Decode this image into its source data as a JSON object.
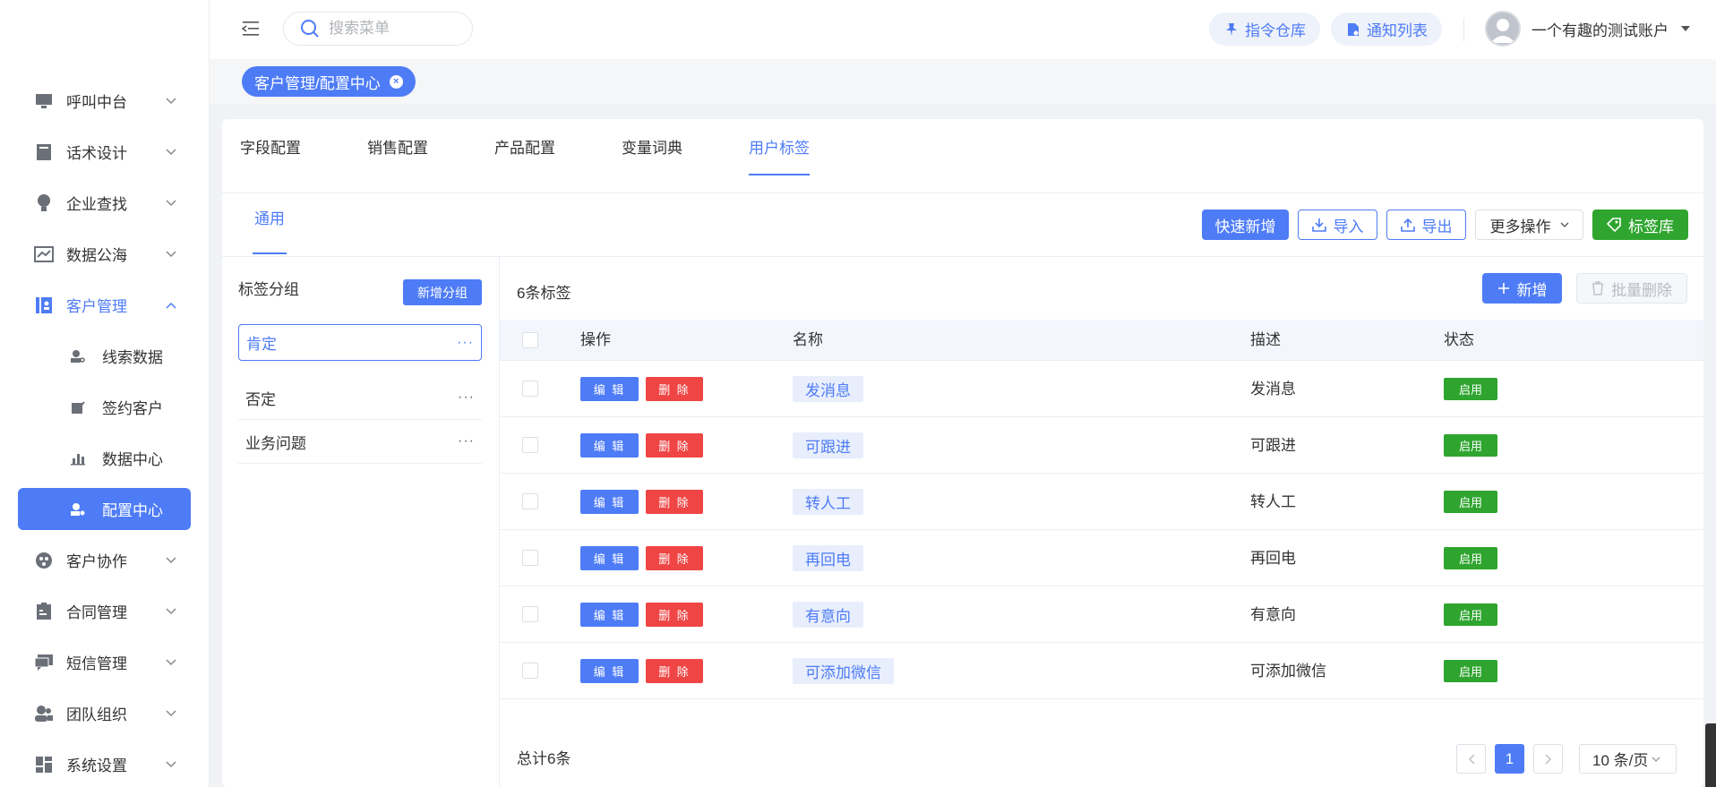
{
  "sidebar": {
    "items": [
      {
        "label": "呼叫中台",
        "icon": "monitor-icon"
      },
      {
        "label": "话术设计",
        "icon": "script-book-icon"
      },
      {
        "label": "企业查找",
        "icon": "bulb-icon"
      },
      {
        "label": "数据公海",
        "icon": "chart-line-icon"
      },
      {
        "label": "客户管理",
        "icon": "contacts-icon",
        "expanded": true
      },
      {
        "label": "客户协作",
        "icon": "collab-icon"
      },
      {
        "label": "合同管理",
        "icon": "contract-icon"
      },
      {
        "label": "短信管理",
        "icon": "message-icon"
      },
      {
        "label": "团队组织",
        "icon": "team-icon"
      },
      {
        "label": "系统设置",
        "icon": "settings-grid-icon"
      }
    ],
    "sub_items": [
      {
        "label": "线索数据",
        "icon": "user-search-icon"
      },
      {
        "label": "签约客户",
        "icon": "sign-icon"
      },
      {
        "label": "数据中心",
        "icon": "bar-chart-icon"
      },
      {
        "label": "配置中心",
        "icon": "user-gear-icon",
        "active": true
      }
    ]
  },
  "header": {
    "search_placeholder": "搜索菜单",
    "command_label": "指令仓库",
    "notice_label": "通知列表",
    "user_name": "一个有趣的测试账户"
  },
  "tagsbar": {
    "active_tag": "客户管理/配置中心"
  },
  "tabs": [
    "字段配置",
    "销售配置",
    "产品配置",
    "变量词典",
    "用户标签"
  ],
  "active_tab": "用户标签",
  "subtab": "通用",
  "toolbar": {
    "quick_add": "快速新增",
    "import": "导入",
    "export": "导出",
    "more": "更多操作",
    "tag_lib": "标签库"
  },
  "groups": {
    "title": "标签分组",
    "add_label": "新增分组",
    "items": [
      "肯定",
      "否定",
      "业务问题"
    ],
    "more_glyph": "···"
  },
  "table": {
    "count_label": "6条标签",
    "add_label": "新增",
    "batch_delete_label": "批量删除",
    "headers": {
      "op": "操作",
      "name": "名称",
      "desc": "描述",
      "status": "状态"
    },
    "edit_label": "编 辑",
    "delete_label": "删 除",
    "rows": [
      {
        "name": "发消息",
        "desc": "发消息",
        "status": "启用"
      },
      {
        "name": "可跟进",
        "desc": "可跟进",
        "status": "启用"
      },
      {
        "name": "转人工",
        "desc": "转人工",
        "status": "启用"
      },
      {
        "name": "再回电",
        "desc": "再回电",
        "status": "启用"
      },
      {
        "name": "有意向",
        "desc": "有意向",
        "status": "启用"
      },
      {
        "name": "可添加微信",
        "desc": "可添加微信",
        "status": "启用"
      }
    ]
  },
  "pagination": {
    "total_label": "总计6条",
    "current_page": "1",
    "page_size": "10 条/页"
  },
  "colors": {
    "accent": "#4e7cf6",
    "danger": "#f04545",
    "success": "#2fa52f"
  }
}
